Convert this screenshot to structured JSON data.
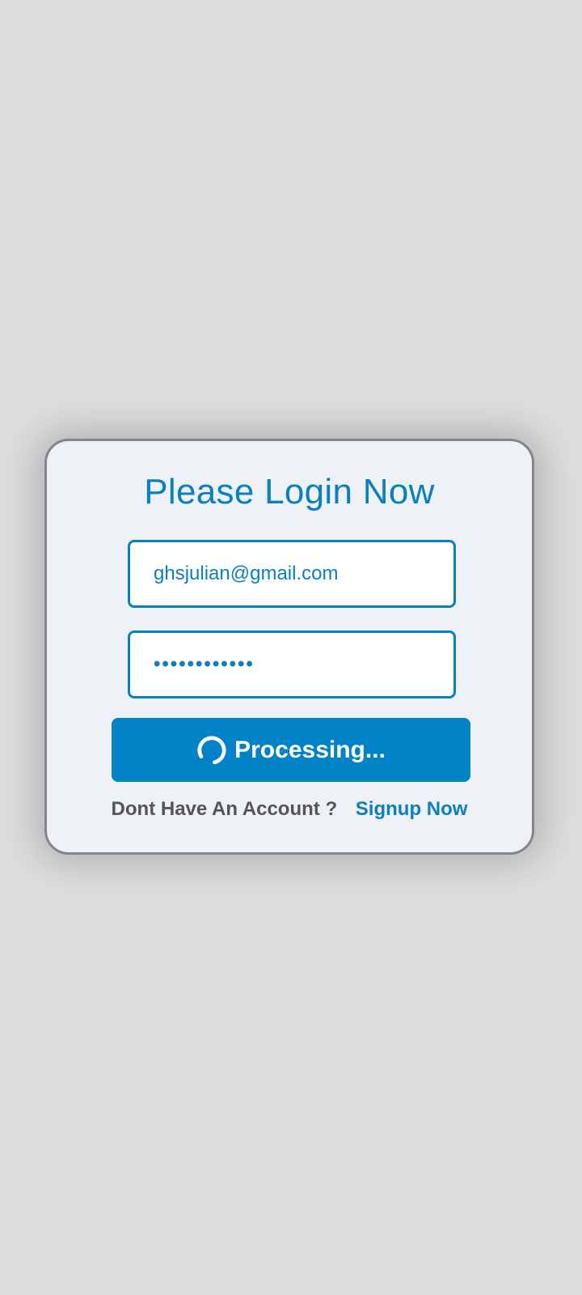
{
  "login": {
    "title": "Please Login Now",
    "email_value": "ghsjulian@gmail.com",
    "password_mask": "••••••••••••",
    "submit_label": "Processing...",
    "submit_icon": "spinner-icon",
    "signup_prompt": "Dont Have An Account ?",
    "signup_link": "Signup Now"
  },
  "colors": {
    "background": "#dcdddf",
    "card": "#eef1f6",
    "accent": "#0282c6",
    "text_muted": "#555557"
  }
}
